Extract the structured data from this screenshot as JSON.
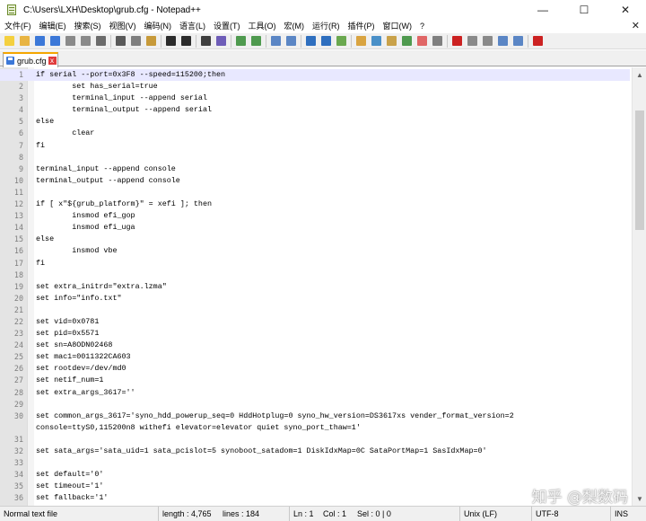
{
  "window": {
    "title": "C:\\Users\\LXH\\Desktop\\grub.cfg - Notepad++",
    "minimize": "—",
    "maximize": "☐",
    "close": "✕"
  },
  "menu": {
    "items": [
      "文件(F)",
      "编辑(E)",
      "搜索(S)",
      "视图(V)",
      "编码(N)",
      "语言(L)",
      "设置(T)",
      "工具(O)",
      "宏(M)",
      "运行(R)",
      "插件(P)",
      "窗口(W)",
      "?"
    ],
    "close_glyph": "✕"
  },
  "toolbar": {
    "buttons": [
      {
        "icon": "new-file-icon",
        "color": "#f4d03f"
      },
      {
        "icon": "open-file-icon",
        "color": "#e8b442"
      },
      {
        "icon": "save-icon",
        "color": "#3c78d8"
      },
      {
        "icon": "save-all-icon",
        "color": "#3c78d8"
      },
      {
        "icon": "close-file-icon",
        "color": "#8a8a8a"
      },
      {
        "icon": "close-all-icon",
        "color": "#8a8a8a"
      },
      {
        "icon": "print-icon",
        "color": "#6b6b6b"
      },
      {
        "icon": "separator"
      },
      {
        "icon": "cut-icon",
        "color": "#5a5a5a"
      },
      {
        "icon": "copy-icon",
        "color": "#7f7f7f"
      },
      {
        "icon": "paste-icon",
        "color": "#c79a3a"
      },
      {
        "icon": "separator"
      },
      {
        "icon": "undo-icon",
        "color": "#2c2c2c"
      },
      {
        "icon": "redo-icon",
        "color": "#2c2c2c"
      },
      {
        "icon": "separator"
      },
      {
        "icon": "find-icon",
        "color": "#3f3f3f"
      },
      {
        "icon": "replace-icon",
        "color": "#6e5db8"
      },
      {
        "icon": "separator"
      },
      {
        "icon": "zoom-in-icon",
        "color": "#4f9a4f"
      },
      {
        "icon": "zoom-out-icon",
        "color": "#4f9a4f"
      },
      {
        "icon": "separator"
      },
      {
        "icon": "sync-vertical-icon",
        "color": "#5b86c5"
      },
      {
        "icon": "sync-horizontal-icon",
        "color": "#5b86c5"
      },
      {
        "icon": "separator"
      },
      {
        "icon": "word-wrap-icon",
        "color": "#2f6fbf"
      },
      {
        "icon": "show-all-chars-icon",
        "color": "#2f6fbf"
      },
      {
        "icon": "indent-guide-icon",
        "color": "#6aa84f"
      },
      {
        "icon": "separator"
      },
      {
        "icon": "udl-icon",
        "color": "#d9a441"
      },
      {
        "icon": "doc-map-icon",
        "color": "#4a90c8"
      },
      {
        "icon": "function-list-icon",
        "color": "#c9a24a"
      },
      {
        "icon": "folder-workspace-icon",
        "color": "#4f9a4f"
      },
      {
        "icon": "doc-switcher-icon",
        "color": "#e06666"
      },
      {
        "icon": "monitoring-icon",
        "color": "#7f7f7f"
      },
      {
        "icon": "separator"
      },
      {
        "icon": "record-macro-icon",
        "color": "#cc2222"
      },
      {
        "icon": "stop-macro-icon",
        "color": "#8a8a8a"
      },
      {
        "icon": "play-macro-icon",
        "color": "#8a8a8a"
      },
      {
        "icon": "run-macro-multiple-icon",
        "color": "#5b86c5"
      },
      {
        "icon": "save-macro-icon",
        "color": "#5b86c5"
      },
      {
        "icon": "separator"
      },
      {
        "icon": "spell-check-icon",
        "color": "#cc2222"
      }
    ]
  },
  "tab": {
    "label": "grub.cfg",
    "close_glyph": "x"
  },
  "editor": {
    "current_line": 1,
    "lines": [
      {
        "n": "1",
        "t": "if serial --port=0x3F8 --speed=115200;then"
      },
      {
        "n": "2",
        "t": "        set has_serial=true"
      },
      {
        "n": "3",
        "t": "        terminal_input --append serial"
      },
      {
        "n": "4",
        "t": "        terminal_output --append serial"
      },
      {
        "n": "5",
        "t": "else"
      },
      {
        "n": "6",
        "t": "        clear"
      },
      {
        "n": "7",
        "t": "fi"
      },
      {
        "n": "8",
        "t": ""
      },
      {
        "n": "9",
        "t": "terminal_input --append console"
      },
      {
        "n": "10",
        "t": "terminal_output --append console"
      },
      {
        "n": "11",
        "t": ""
      },
      {
        "n": "12",
        "t": "if [ x\"${grub_platform}\" = xefi ]; then"
      },
      {
        "n": "13",
        "t": "        insmod efi_gop"
      },
      {
        "n": "14",
        "t": "        insmod efi_uga"
      },
      {
        "n": "15",
        "t": "else"
      },
      {
        "n": "16",
        "t": "        insmod vbe"
      },
      {
        "n": "17",
        "t": "fi"
      },
      {
        "n": "18",
        "t": ""
      },
      {
        "n": "19",
        "t": "set extra_initrd=\"extra.lzma\""
      },
      {
        "n": "20",
        "t": "set info=\"info.txt\""
      },
      {
        "n": "21",
        "t": ""
      },
      {
        "n": "22",
        "t": "set vid=0x0781"
      },
      {
        "n": "23",
        "t": "set pid=0x5571"
      },
      {
        "n": "24",
        "t": "set sn=A8ODN02468"
      },
      {
        "n": "25",
        "t": "set mac1=0011322CA603"
      },
      {
        "n": "26",
        "t": "set rootdev=/dev/md0"
      },
      {
        "n": "27",
        "t": "set netif_num=1"
      },
      {
        "n": "28",
        "t": "set extra_args_3617=''"
      },
      {
        "n": "29",
        "t": ""
      },
      {
        "n": "30",
        "t": "set common_args_3617='syno_hdd_powerup_seq=0 HddHotplug=0 syno_hw_version=DS3617xs vender_format_version=2"
      },
      {
        "n": "",
        "t": "console=ttyS0,115200n8 withefi elevator=elevator quiet syno_port_thaw=1'"
      },
      {
        "n": "31",
        "t": ""
      },
      {
        "n": "32",
        "t": "set sata_args='sata_uid=1 sata_pcislot=5 synoboot_satadom=1 DiskIdxMap=0C SataPortMap=1 SasIdxMap=0'"
      },
      {
        "n": "33",
        "t": ""
      },
      {
        "n": "34",
        "t": "set default='0'"
      },
      {
        "n": "35",
        "t": "set timeout='1'"
      },
      {
        "n": "36",
        "t": "set fallback='1'"
      }
    ]
  },
  "scrollbar": {
    "up_glyph": "▲",
    "down_glyph": "▼"
  },
  "watermark": "知乎 @梨数码",
  "status": {
    "file_type": "Normal text file",
    "length": "length : 4,765",
    "lines": "lines : 184",
    "ln": "Ln : 1",
    "col": "Col : 1",
    "sel": "Sel : 0 | 0",
    "eol": "Unix (LF)",
    "encoding": "UTF-8",
    "mode": "INS"
  },
  "colors": {
    "current_line": "#e8e8ff",
    "tab_accent": "#f4a600",
    "line_number": "#7d7d7d"
  }
}
